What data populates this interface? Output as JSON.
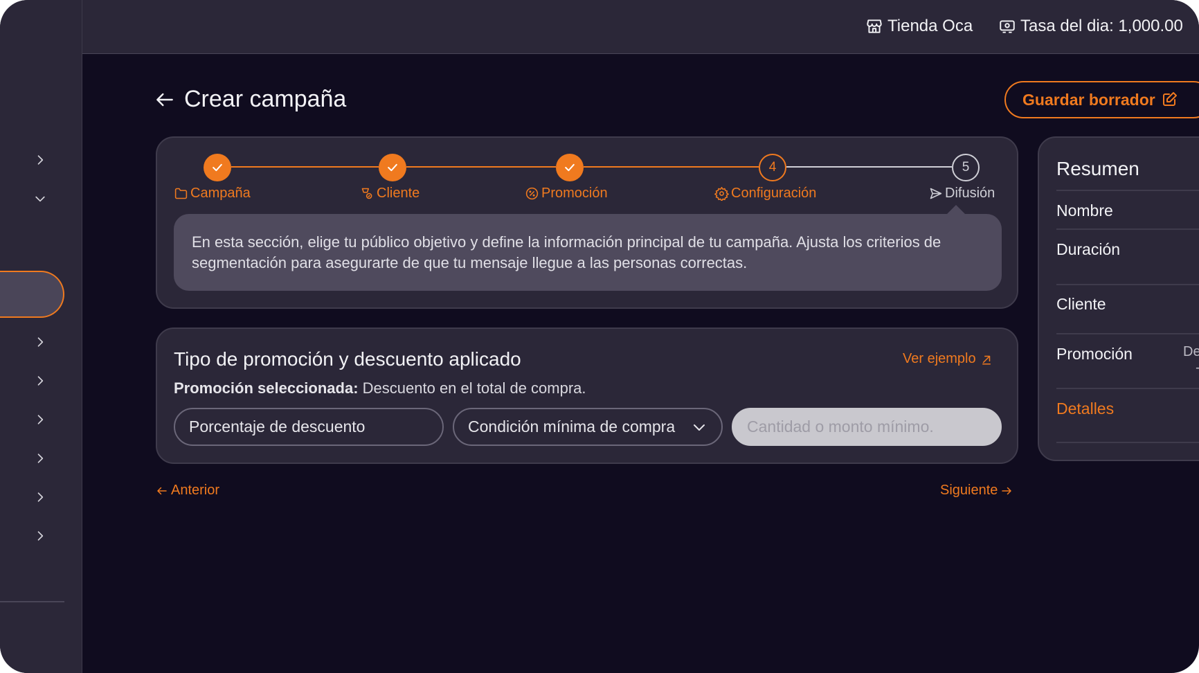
{
  "header": {
    "store_name": "Tienda Oca",
    "exchange_rate": "Tasa del dia: 1,000.00"
  },
  "page": {
    "title": "Crear campaña",
    "save_draft": "Guardar borrador"
  },
  "stepper": {
    "steps": [
      {
        "label": "Campaña",
        "number": "1",
        "status": "done",
        "icon": "folder-icon"
      },
      {
        "label": "Cliente",
        "number": "2",
        "status": "done",
        "icon": "user-heart-icon"
      },
      {
        "label": "Promoción",
        "number": "3",
        "status": "done",
        "icon": "percent-badge-icon"
      },
      {
        "label": "Configuración",
        "number": "4",
        "status": "current",
        "icon": "gear-icon"
      },
      {
        "label": "Difusión",
        "number": "5",
        "status": "pending",
        "icon": "send-icon"
      }
    ],
    "description": "En esta sección, elige tu público objetivo y define la información principal de tu campaña. Ajusta los criterios de segmentación para asegurarte de que tu mensaje llegue a las personas correctas."
  },
  "promo": {
    "title": "Tipo de promoción y descuento aplicado",
    "example_link": "Ver ejemplo",
    "selected_label": "Promoción seleccionada:",
    "selected_value": "Descuento en el total de compra.",
    "discount_placeholder": "Porcentaje de descuento",
    "condition_select": "Condición mínima de compra",
    "minimum_placeholder": "Cantidad o monto mínimo."
  },
  "navigation": {
    "previous": "Anterior",
    "next": "Siguiente"
  },
  "summary": {
    "title": "Resumen",
    "rows": [
      "Nombre",
      "Duración",
      "Cliente",
      "Promoción"
    ],
    "details_link": "Detalles",
    "clipped_text_1": "De",
    "clipped_text_2": "-"
  },
  "colors": {
    "accent": "#f07a1f",
    "background": "#100c1f",
    "surface": "#2b2738"
  }
}
